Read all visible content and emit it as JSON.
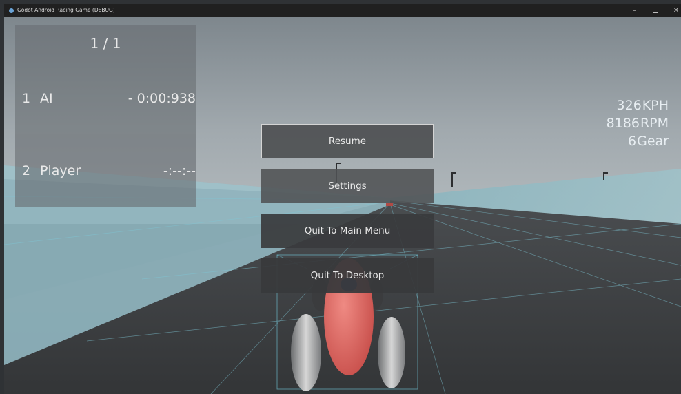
{
  "window": {
    "title": "Godot Android Racing Game (DEBUG)",
    "controls": {
      "minimize": "–",
      "close": "✕"
    }
  },
  "leaderboard": {
    "lap": "1 / 1",
    "rows": [
      {
        "position": "1",
        "name": "AI",
        "time": "- 0:00:938"
      },
      {
        "position": "2",
        "name": "Player",
        "time": "-:--:--"
      }
    ]
  },
  "telemetry": {
    "speed": {
      "value": "326",
      "unit": "KPH"
    },
    "rpm": {
      "value": "8186",
      "unit": "RPM"
    },
    "gear": {
      "value": "6",
      "unit": "Gear"
    }
  },
  "pause_menu": {
    "resume": "Resume",
    "settings": "Settings",
    "quit_main_menu": "Quit To Main Menu",
    "quit_desktop": "Quit To Desktop"
  },
  "colors": {
    "sky": "#9aa4aa",
    "track": "#3b3d3f",
    "barrier": "#8fb7c1",
    "car_body": "#d9615b",
    "car_cap": "#3c4b8c"
  }
}
